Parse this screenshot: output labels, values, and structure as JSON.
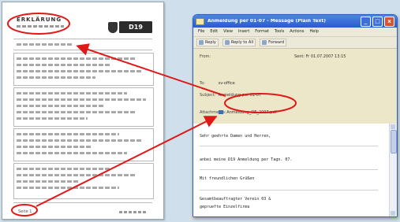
{
  "document": {
    "title": "ERKLÄRUNG",
    "logo_text": "D19",
    "footer_left": "Seite 1"
  },
  "email": {
    "title": "Anmeldung per 01-07 - Message (Plain Text)",
    "window_buttons": [
      "_",
      "□",
      "x"
    ],
    "menu": [
      "File",
      "Edit",
      "View",
      "Insert",
      "Format",
      "Tools",
      "Actions",
      "Help"
    ],
    "toolbar": [
      {
        "label": "Reply",
        "icon": "reply-icon"
      },
      {
        "label": "Reply to All",
        "icon": "reply-all-icon"
      },
      {
        "label": "Forward",
        "icon": "forward-icon"
      }
    ],
    "headers": {
      "from_label": "From:",
      "sent_label": "Sent:",
      "sent_value": "Fr 01.07.2007 13:15",
      "to_label": "To:",
      "to_value": "sv-office",
      "subject_label": "Subject:",
      "subject_value": "Anmeldung per 01-07",
      "attach_label": "Attachments:",
      "attach_value": "Anmeldung_OE_2007.pdf"
    },
    "body_lines": [
      "Sehr geehrte Damen und Herren,",
      "anbei meine D19 Anmeldung per Tagn. 07.",
      "Mit freundlichen Grüßen",
      "Gesamtbeauftragter Verein 03 &",
      "gepruefte Einzelfirma"
    ]
  },
  "annotations": {
    "color": "#e01818"
  }
}
